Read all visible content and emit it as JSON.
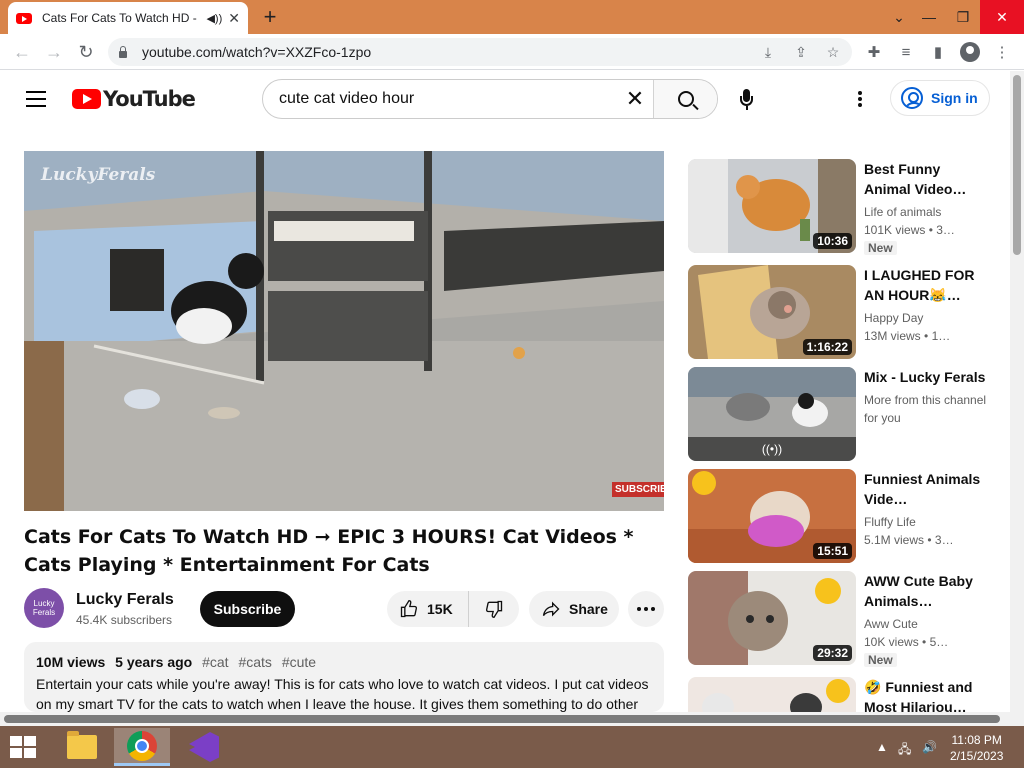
{
  "browser": {
    "tab_title": "Cats For Cats To Watch HD -",
    "new_tab": "+",
    "url": "youtube.com/watch?v=XXZFco-1zpo"
  },
  "header": {
    "logo_text": "YouTube",
    "search_value": "cute cat video hour",
    "signin_label": "Sign in"
  },
  "video": {
    "watermark": "LuckyFerals",
    "subscribe_badge": "SUBSCRIBE",
    "title": "Cats For Cats To Watch HD ➞ EPIC 3 HOURS! Cat Videos * Cats Playing * Entertainment For Cats",
    "channel": "Lucky Ferals",
    "avatar_text": "Lucky Ferals",
    "subscribers": "45.4K subscribers",
    "subscribe_label": "Subscribe",
    "likes": "15K",
    "share_label": "Share",
    "views": "10M views",
    "age": "5 years ago",
    "tags": [
      "#cat",
      "#cats",
      "#cute"
    ],
    "description": "Entertain your cats while you're away! This is for cats who love to watch cat videos. I put cat videos on my smart TV for the cats to watch when I leave the house. It gives them something to do other"
  },
  "related": [
    {
      "title": "Best Funny Animal Video…",
      "channel": "Life of animals",
      "views": "101K views",
      "age": "3…",
      "duration": "10:36",
      "badge": "New"
    },
    {
      "title": "I LAUGHED FOR AN HOUR😹…",
      "channel": "Happy Day",
      "views": "13M views",
      "age": "1…",
      "duration": "1:16:22",
      "badge": ""
    },
    {
      "title": "Mix - Lucky Ferals",
      "channel": "More from this channel for you",
      "views": "",
      "age": "",
      "duration": "((•))",
      "badge": ""
    },
    {
      "title": "Funniest Animals Vide…",
      "channel": "Fluffy Life",
      "views": "5.1M views",
      "age": "3…",
      "duration": "15:51",
      "badge": ""
    },
    {
      "title": "AWW Cute Baby Animals…",
      "channel": "Aww Cute",
      "views": "10K views",
      "age": "5…",
      "duration": "29:32",
      "badge": "New"
    },
    {
      "title": "🤣 Funniest and Most Hilariou…",
      "channel": "",
      "views": "",
      "age": "",
      "duration": "",
      "badge": ""
    }
  ],
  "taskbar": {
    "time": "11:08 PM",
    "date": "2/15/2023"
  },
  "colors": {
    "youtube_red": "#ff0000",
    "link_blue": "#065fd4",
    "titlebar": "#d8844a",
    "taskbar": "#7a5b4a"
  }
}
